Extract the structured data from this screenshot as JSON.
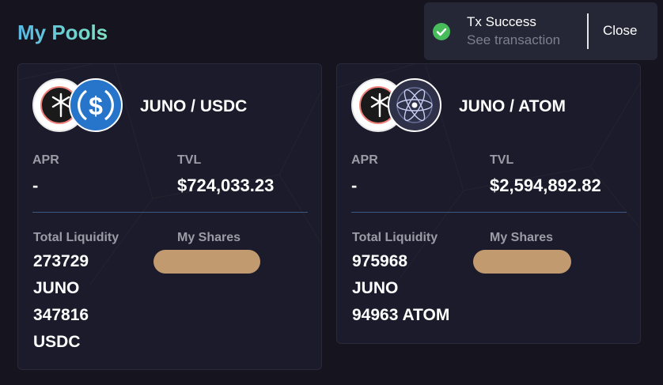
{
  "page": {
    "title": "My Pools",
    "colors": {
      "background": "#15141f",
      "card": "#1c1b2b",
      "accent": "#5ec4d6",
      "shares_pill": "#c29a70",
      "success": "#48bb5b"
    }
  },
  "toast": {
    "title": "Tx Success",
    "link": "See transaction",
    "close_label": "Close",
    "icon": "check-circle-icon"
  },
  "pools": [
    {
      "pair": "JUNO / USDC",
      "token_icons": [
        "juno-token-icon",
        "usdc-token-icon"
      ],
      "apr_label": "APR",
      "apr_value": "-",
      "tvl_label": "TVL",
      "tvl_value": "$724,033.23",
      "liquidity_label": "Total Liquidity",
      "liquidity_lines": [
        "273729",
        "JUNO",
        "347816",
        "USDC"
      ],
      "shares_label": "My Shares"
    },
    {
      "pair": "JUNO / ATOM",
      "token_icons": [
        "juno-token-icon",
        "atom-token-icon"
      ],
      "apr_label": "APR",
      "apr_value": "-",
      "tvl_label": "TVL",
      "tvl_value": "$2,594,892.82",
      "liquidity_label": "Total Liquidity",
      "liquidity_lines": [
        "975968",
        "JUNO",
        "94963 ATOM"
      ],
      "shares_label": "My Shares"
    }
  ]
}
